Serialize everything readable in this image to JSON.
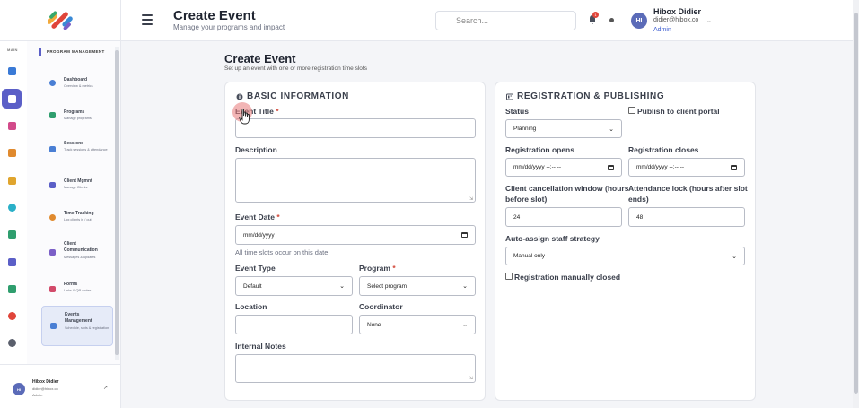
{
  "header": {
    "title": "Create Event",
    "subtitle": "Manage your programs and impact",
    "search_placeholder": "Search...",
    "notification_count": "1",
    "user": {
      "initials": "HI",
      "name": "Hibox Didier",
      "email": "didier@hibox.co",
      "role": "Admin"
    }
  },
  "sidebar": {
    "rail_label": "MAIN",
    "section_label": "PROGRAM MANAGEMENT",
    "items": [
      {
        "title": "Dashboard",
        "sub": "Overview & metrics",
        "icon": "dashboard-icon",
        "color": "#4a7fd4"
      },
      {
        "title": "Programs",
        "sub": "Manage programs",
        "icon": "programs-icon",
        "color": "#2f9e6e"
      },
      {
        "title": "Sessions",
        "sub": "Track sessions & attendance",
        "icon": "sessions-icon",
        "color": "#4a7fd4"
      },
      {
        "title": "Client Mgmnt",
        "sub": "Manage Clients",
        "icon": "clients-icon",
        "color": "#5b5fc7"
      },
      {
        "title": "Time Tracking",
        "sub": "Log clients in / out",
        "icon": "time-icon",
        "color": "#e08a2e"
      },
      {
        "title": "Client Communication",
        "sub": "Messages & updates",
        "icon": "communication-icon",
        "color": "#7b5fc7"
      },
      {
        "title": "Forms",
        "sub": "Links & QR codes",
        "icon": "forms-icon",
        "color": "#d24a6a"
      },
      {
        "title": "Events Management",
        "sub": "Schedule, slots & registration",
        "icon": "events-icon",
        "color": "#4a7fd4"
      }
    ],
    "footer": {
      "initials": "HI",
      "name": "Hibox Didier",
      "email": "didier@hibox.co",
      "role": "Admin"
    }
  },
  "page": {
    "title": "Create Event",
    "subtitle": "Set up an event with one or more registration time slots"
  },
  "basic": {
    "heading": "BASIC INFORMATION",
    "event_title_label": "Event Title",
    "description_label": "Description",
    "event_date_label": "Event Date",
    "event_date_placeholder": "mm/dd/yyyy",
    "date_hint": "All time slots occur on this date.",
    "event_type_label": "Event Type",
    "event_type_value": "Default",
    "program_label": "Program",
    "program_value": "Select program",
    "location_label": "Location",
    "coordinator_label": "Coordinator",
    "coordinator_value": "None",
    "notes_label": "Internal Notes",
    "required_mark": "*"
  },
  "registration": {
    "heading": "REGISTRATION & PUBLISHING",
    "status_label": "Status",
    "status_value": "Planning",
    "publish_label": "Publish to client portal",
    "opens_label": "Registration opens",
    "opens_placeholder": "mm/dd/yyyy --:-- --",
    "closes_label": "Registration closes",
    "closes_placeholder": "mm/dd/yyyy --:-- --",
    "cancel_label_1": "Client cancellation window (hours",
    "cancel_label_2": "before slot)",
    "cancel_value": "24",
    "lock_label_1": "Attendance lock (hours after slot",
    "lock_label_2": "ends)",
    "lock_value": "48",
    "strategy_label": "Auto-assign staff strategy",
    "strategy_value": "Manual only",
    "manual_closed_label": "Registration manually closed"
  }
}
